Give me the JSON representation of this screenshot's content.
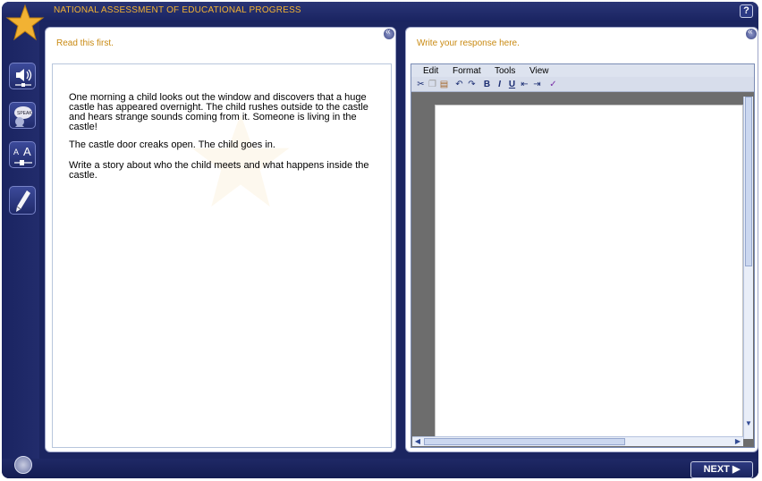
{
  "app": {
    "title": "NATIONAL ASSESSMENT OF EDUCATIONAL PROGRESS",
    "help_label": "?"
  },
  "toolbar_icons": [
    "speaker-volume-icon",
    "speak-bubble-icon",
    "text-size-icon",
    "pencil-icon",
    "settings-icon"
  ],
  "left_panel": {
    "heading": "Read this first.",
    "paragraphs": [
      "One morning a child looks out the window and discovers that a huge castle has appeared overnight. The child rushes outside to the castle and hears strange sounds coming from it. Someone is living in the castle!",
      "The castle door creaks open. The child goes in.",
      "Write a story about who the child meets and what happens inside the castle."
    ]
  },
  "right_panel": {
    "heading": "Write your response here.",
    "menu": [
      "Edit",
      "Format",
      "Tools",
      "View"
    ],
    "format_buttons": {
      "bold": "B",
      "italic": "I",
      "underline": "U"
    }
  },
  "footer": {
    "next_label": "NEXT ▶"
  },
  "colors": {
    "frame": "#1b2560",
    "accent_orange": "#f2b233",
    "heading": "#c98a12"
  }
}
